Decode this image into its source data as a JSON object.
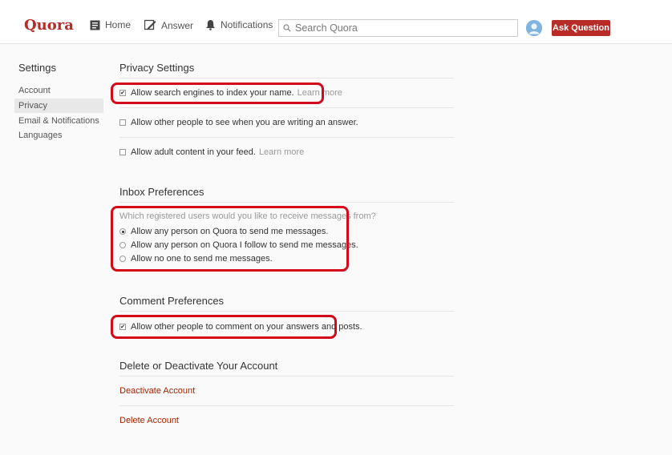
{
  "header": {
    "logo": "Quora",
    "nav": {
      "home": "Home",
      "answer": "Answer",
      "notifications": "Notifications"
    },
    "search_placeholder": "Search Quora",
    "ask_button": "Ask Question",
    "brand_color": "#b92b27"
  },
  "sidebar": {
    "title": "Settings",
    "items": [
      {
        "label": "Account",
        "active": false
      },
      {
        "label": "Privacy",
        "active": true
      },
      {
        "label": "Email & Notifications",
        "active": false
      },
      {
        "label": "Languages",
        "active": false
      }
    ]
  },
  "privacy": {
    "title": "Privacy Settings",
    "options": [
      {
        "label": "Allow search engines to index your name.",
        "checked": true,
        "learn_more": "Learn more"
      },
      {
        "label": "Allow other people to see when you are writing an answer.",
        "checked": false
      },
      {
        "label": "Allow adult content in your feed.",
        "checked": false,
        "learn_more": "Learn more"
      }
    ]
  },
  "inbox": {
    "title": "Inbox Preferences",
    "question": "Which registered users would you like to receive messages from?",
    "options": [
      {
        "label": "Allow any person on Quora to send me messages.",
        "selected": true
      },
      {
        "label": "Allow any person on Quora I follow to send me messages.",
        "selected": false
      },
      {
        "label": "Allow no one to send me messages.",
        "selected": false
      }
    ]
  },
  "comments": {
    "title": "Comment Preferences",
    "option": {
      "label": "Allow other people to comment on your answers and posts.",
      "checked": true
    }
  },
  "account": {
    "title": "Delete or Deactivate Your Account",
    "deactivate": "Deactivate Account",
    "delete": "Delete Account"
  },
  "highlight_color": "#d40a1b"
}
